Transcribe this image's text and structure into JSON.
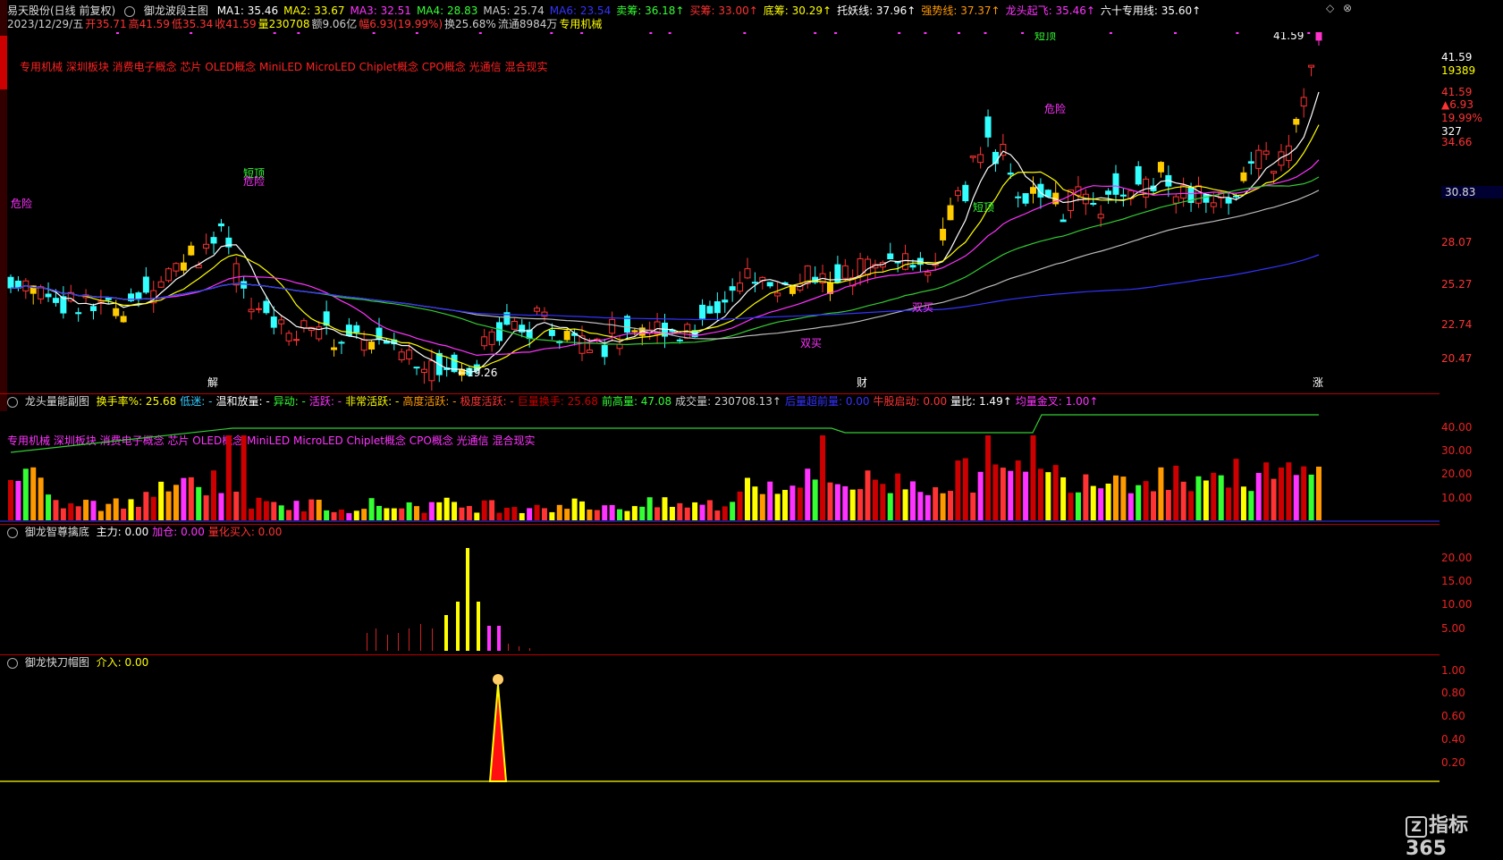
{
  "header": {
    "stock": "易天股份(日线 前复权)",
    "indicator_main": "御龙波段主图",
    "items": [
      {
        "label": "MA1: 35.46",
        "color": "#ffffff"
      },
      {
        "label": "MA2: 33.67",
        "color": "#ffff00"
      },
      {
        "label": "MA3: 32.51",
        "color": "#ff33ff"
      },
      {
        "label": "MA4: 28.83",
        "color": "#33ff33"
      },
      {
        "label": "MA5: 25.74",
        "color": "#cccccc"
      },
      {
        "label": "MA6: 23.54",
        "color": "#3333ff"
      },
      {
        "label": "卖筹: 36.18↑",
        "color": "#33ff33"
      },
      {
        "label": "买筹: 33.00↑",
        "color": "#ff3333"
      },
      {
        "label": "底筹: 30.29↑",
        "color": "#ffff00"
      },
      {
        "label": "托妖线: 37.96↑",
        "color": "#ffffff"
      },
      {
        "label": "强势线: 37.37↑",
        "color": "#ff9900"
      },
      {
        "label": "龙头起飞: 35.46↑",
        "color": "#ff33ff"
      },
      {
        "label": "六十专用线: 35.60↑",
        "color": "#ffffff"
      }
    ],
    "row2": [
      {
        "label": "2023/12/29/五",
        "color": "#cccccc"
      },
      {
        "label": "开35.71",
        "color": "#ff3333"
      },
      {
        "label": "高41.59",
        "color": "#ff3333"
      },
      {
        "label": "低35.34",
        "color": "#ff3333"
      },
      {
        "label": "收41.59",
        "color": "#ff3333"
      },
      {
        "label": "量230708",
        "color": "#ffff00"
      },
      {
        "label": "额9.06亿",
        "color": "#cccccc"
      },
      {
        "label": "幅6.93(19.99%)",
        "color": "#ff3333"
      },
      {
        "label": "换25.68%",
        "color": "#cccccc"
      },
      {
        "label": "流通8984万",
        "color": "#cccccc"
      },
      {
        "label": "专用机械",
        "color": "#ffff00"
      }
    ],
    "concepts": "专用机械 深圳板块 消费电子概念 芯片 OLED概念 MiniLED MicroLED Chiplet概念 CPO概念 光通信 混合现实"
  },
  "main_chart": {
    "right_scale": [
      "41.59",
      "19389",
      "41.59",
      "▲6.93",
      "19.99%",
      "327",
      "34.66",
      "30.83",
      "28.07",
      "25.27",
      "22.74",
      "20.47"
    ],
    "labels": [
      {
        "text": "危险",
        "color": "#ff33ff"
      },
      {
        "text": "短顶",
        "color": "#33ff33"
      },
      {
        "text": "危险",
        "color": "#ff33ff"
      },
      {
        "text": "短顶",
        "color": "#33ff33"
      },
      {
        "text": "危险",
        "color": "#ff33ff"
      },
      {
        "text": "短顶",
        "color": "#33ff33"
      },
      {
        "text": "双买",
        "color": "#ff33ff"
      },
      {
        "text": "双买",
        "color": "#ff33ff"
      },
      {
        "text": "←19.26",
        "color": "#ffffff"
      },
      {
        "text": "41.59",
        "color": "#ffffff"
      },
      {
        "text": "解",
        "color": "#ffffff"
      },
      {
        "text": "财",
        "color": "#ffffff"
      },
      {
        "text": "涨",
        "color": "#ffffff"
      }
    ]
  },
  "vol_panel": {
    "title": "龙头量能副图",
    "items": [
      {
        "label": "换手率%: 25.68",
        "color": "#ffff00"
      },
      {
        "label": "低迷: -",
        "color": "#33ccff"
      },
      {
        "label": "温和放量: -",
        "color": "#ffffff"
      },
      {
        "label": "异动: -",
        "color": "#33ff33"
      },
      {
        "label": "活跃: -",
        "color": "#ff33ff"
      },
      {
        "label": "非常活跃: -",
        "color": "#ffff00"
      },
      {
        "label": "高度活跃: -",
        "color": "#ff9900"
      },
      {
        "label": "极度活跃: -",
        "color": "#ff3333"
      },
      {
        "label": "巨量换手: 25.68",
        "color": "#cc0000"
      },
      {
        "label": "前高量: 47.08",
        "color": "#33ff33"
      },
      {
        "label": "成交量: 230708.13↑",
        "color": "#cccccc"
      },
      {
        "label": "后量超前量: 0.00",
        "color": "#3333ff"
      },
      {
        "label": "牛股启动: 0.00",
        "color": "#ff3333"
      },
      {
        "label": "量比: 1.49↑",
        "color": "#ffffff"
      },
      {
        "label": "均量金叉: 1.00↑",
        "color": "#ff33ff"
      }
    ],
    "concepts": "专用机械 深圳板块 消费电子概念 芯片 OLED概念 MiniLED MicroLED Chiplet概念 CPO概念 光通信 混合现实",
    "scale": [
      "40.00",
      "30.00",
      "20.00",
      "10.00"
    ]
  },
  "zz_panel": {
    "title": "御龙智尊擒底",
    "items": [
      {
        "label": "主力: 0.00",
        "color": "#ffffff"
      },
      {
        "label": "加仓: 0.00",
        "color": "#ff33ff"
      },
      {
        "label": "量化买入: 0.00",
        "color": "#ff3333"
      }
    ],
    "scale": [
      "20.00",
      "15.00",
      "10.00",
      "5.00"
    ]
  },
  "kd_panel": {
    "title": "御龙快刀帽图",
    "items": [
      {
        "label": "介入: 0.00",
        "color": "#ffff00"
      }
    ],
    "scale": [
      "1.00",
      "0.80",
      "0.60",
      "0.40",
      "0.20"
    ]
  },
  "watermark": "指标365",
  "watermark_icon": "Z"
}
